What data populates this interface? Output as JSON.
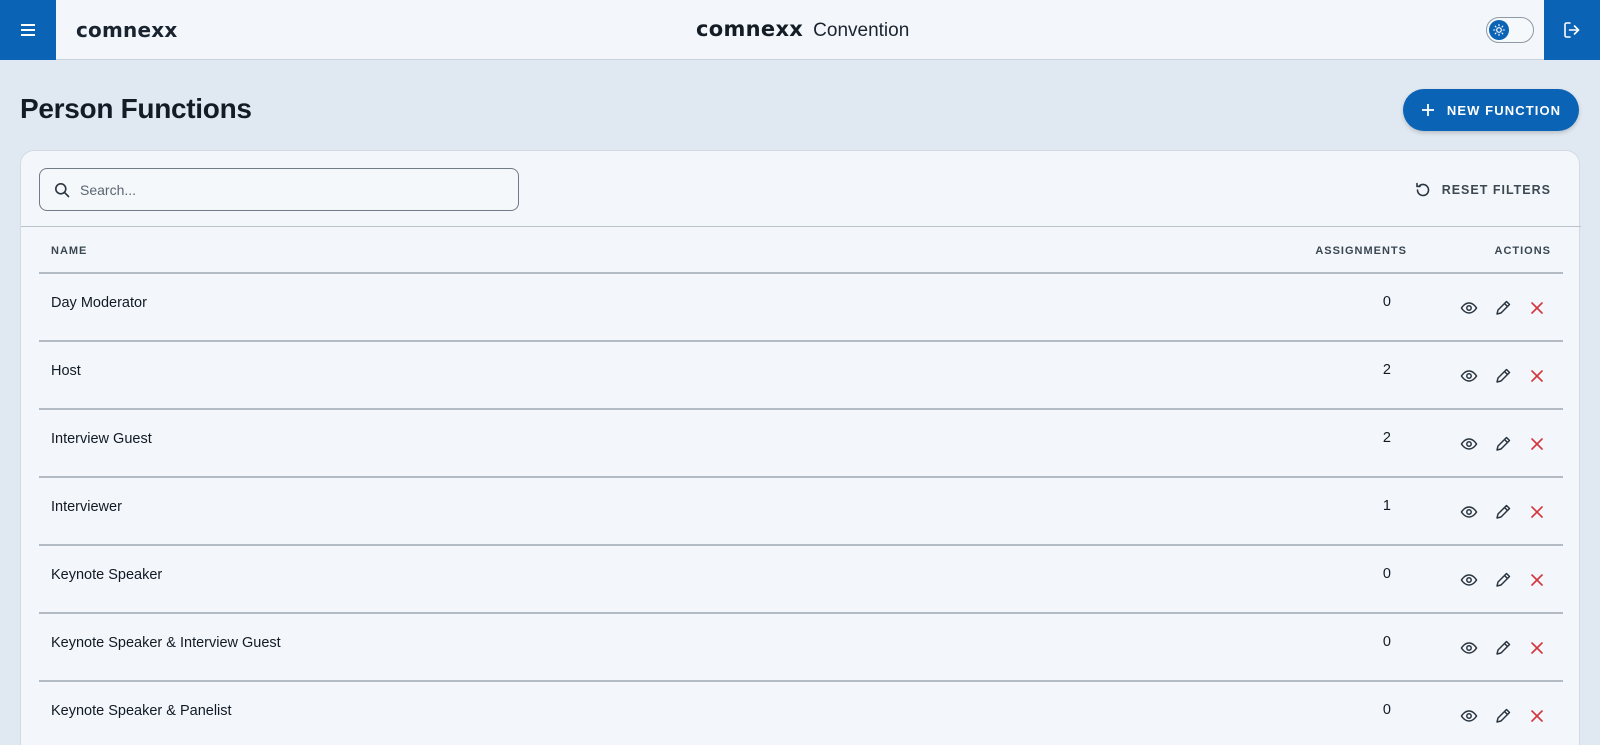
{
  "header": {
    "brand_left": "comnexx",
    "brand_logo": "comnexx",
    "product_name": "Convention",
    "menu_icon": "hamburger-icon",
    "theme_toggle_icon": "sun-icon",
    "logout_icon": "logout-icon"
  },
  "page": {
    "title": "Person Functions",
    "new_button_label": "NEW FUNCTION"
  },
  "filters": {
    "search_placeholder": "Search...",
    "search_value": "",
    "reset_label": "RESET FILTERS"
  },
  "table": {
    "columns": [
      "NAME",
      "ASSIGNMENTS",
      "ACTIONS"
    ],
    "rows": [
      {
        "name": "Day Moderator",
        "assignments": "0"
      },
      {
        "name": "Host",
        "assignments": "2"
      },
      {
        "name": "Interview Guest",
        "assignments": "2"
      },
      {
        "name": "Interviewer",
        "assignments": "1"
      },
      {
        "name": "Keynote Speaker",
        "assignments": "0"
      },
      {
        "name": "Keynote Speaker & Interview Guest",
        "assignments": "0"
      },
      {
        "name": "Keynote Speaker & Panelist",
        "assignments": "0"
      }
    ]
  },
  "colors": {
    "brand_blue": "#0a63b5",
    "delete_red": "#d4343a",
    "background": "#e0e8f1",
    "surface": "#f3f7fb"
  }
}
